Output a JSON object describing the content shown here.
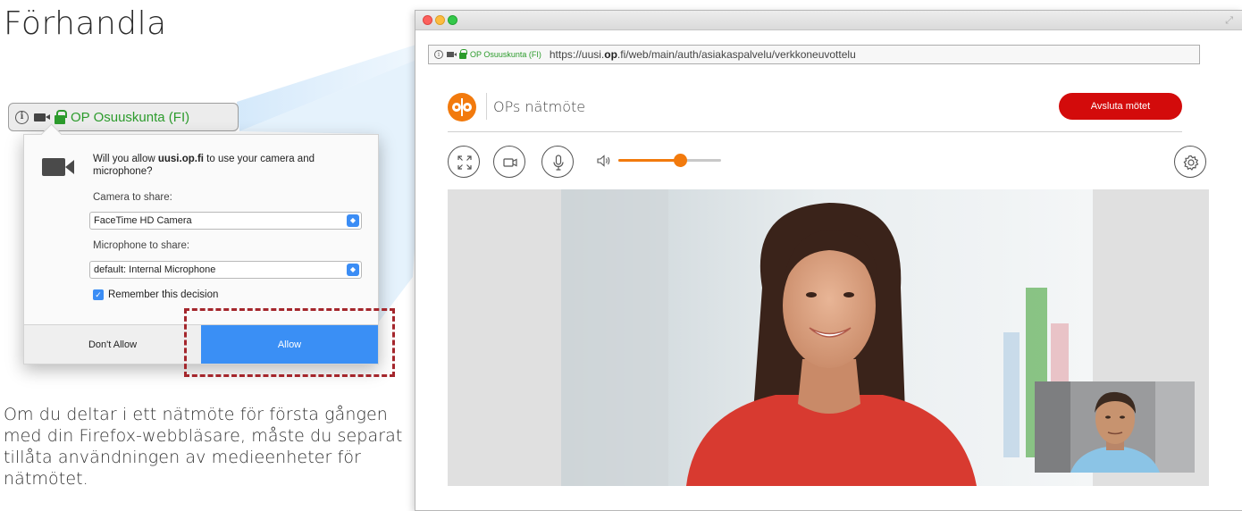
{
  "heading": "Förhandla",
  "firefox_prompt": {
    "identity": "OP Osuuskunta (FI)",
    "question_pre": "Will you allow ",
    "question_domain": "uusi.op.fi",
    "question_post": " to use your camera and microphone?",
    "camera_label": "Camera to share:",
    "camera_value": "FaceTime HD Camera",
    "mic_label": "Microphone to share:",
    "mic_value": "default: Internal Microphone",
    "remember_label": "Remember this decision",
    "deny_label": "Don't Allow",
    "allow_label": "Allow"
  },
  "description": "Om du deltar i ett nätmöte för första gången med din Firefox-webbläsare, måste du separat tillåta användningen av medieenheter för nätmötet.",
  "browser": {
    "identity": "OP Osuuskunta (FI)",
    "url_prefix": "https://uusi.",
    "url_bold": "op",
    "url_suffix": ".fi/web/main/auth/asiakaspalvelu/verkkoneuvottelu"
  },
  "app": {
    "title": "OPs nätmöte",
    "end_button": "Avsluta mötet",
    "brand_color": "#f27a0d",
    "end_color": "#d30b0b",
    "volume_level": 0.6
  },
  "icons": {
    "fullscreen": "fullscreen-icon",
    "camera": "camera-icon",
    "microphone": "microphone-icon",
    "volume": "volume-icon",
    "settings": "gear-icon"
  }
}
